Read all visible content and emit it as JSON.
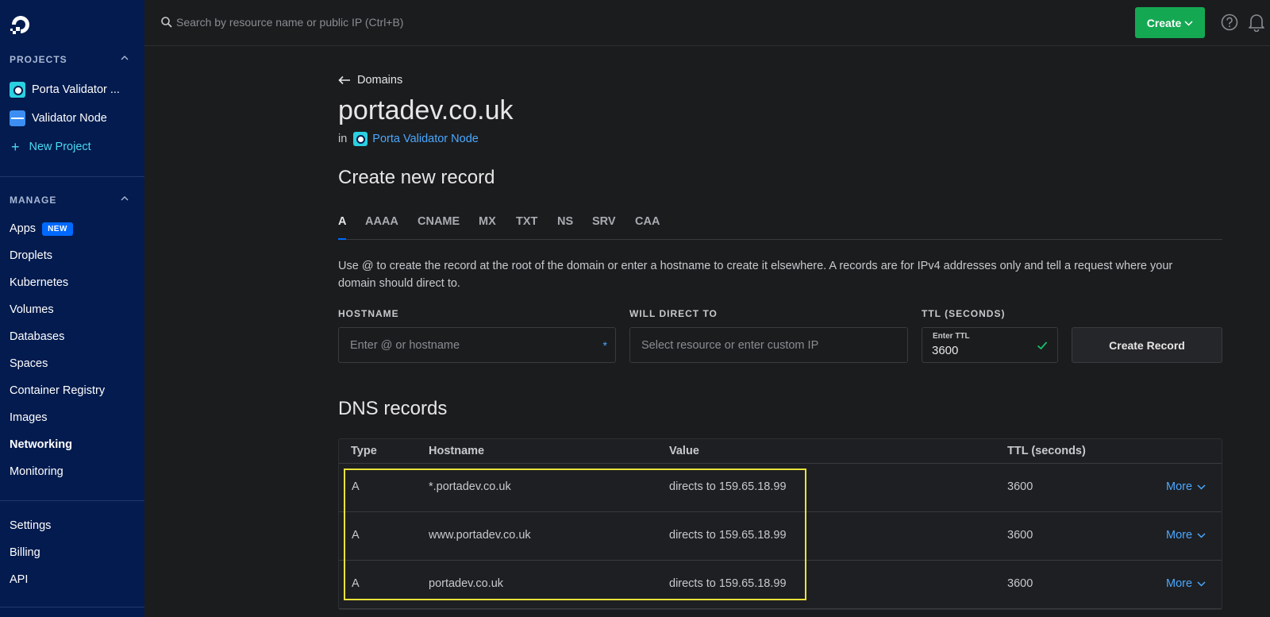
{
  "sidebar": {
    "projects_heading": "PROJECTS",
    "projects": [
      {
        "label": "Porta Validator ..."
      },
      {
        "label": "Validator Node"
      }
    ],
    "new_project": "New Project",
    "manage_heading": "MANAGE",
    "manage_items": [
      {
        "label": "Apps",
        "badge": "NEW"
      },
      {
        "label": "Droplets"
      },
      {
        "label": "Kubernetes"
      },
      {
        "label": "Volumes"
      },
      {
        "label": "Databases"
      },
      {
        "label": "Spaces"
      },
      {
        "label": "Container Registry"
      },
      {
        "label": "Images"
      },
      {
        "label": "Networking"
      },
      {
        "label": "Monitoring"
      }
    ],
    "bottom_items": [
      {
        "label": "Settings"
      },
      {
        "label": "Billing"
      },
      {
        "label": "API"
      }
    ]
  },
  "topbar": {
    "search_placeholder": "Search by resource name or public IP (Ctrl+B)",
    "create_label": "Create"
  },
  "page": {
    "back_label": "Domains",
    "domain": "portadev.co.uk",
    "in_label": "in",
    "project_link": "Porta Validator Node",
    "create_title": "Create new record",
    "tabs": [
      "A",
      "AAAA",
      "CNAME",
      "MX",
      "TXT",
      "NS",
      "SRV",
      "CAA"
    ],
    "description": "Use @ to create the record at the root of the domain or enter a hostname to create it elsewhere. A records are for IPv4 addresses only and tell a request where your domain should direct to.",
    "hostname_label": "HOSTNAME",
    "hostname_placeholder": "Enter @ or hostname",
    "required_mark": "*",
    "direct_label": "WILL DIRECT TO",
    "direct_placeholder": "Select resource or enter custom IP",
    "ttl_label": "TTL (SECONDS)",
    "ttl_inner_label": "Enter TTL",
    "ttl_value": "3600",
    "create_record_label": "Create Record",
    "dns_title": "DNS records"
  },
  "dns_table": {
    "headers": [
      "Type",
      "Hostname",
      "Value",
      "TTL (seconds)"
    ],
    "rows": [
      {
        "type": "A",
        "hostname": "*.portadev.co.uk",
        "value": "directs to 159.65.18.99",
        "ttl": "3600",
        "action": "More"
      },
      {
        "type": "A",
        "hostname": "www.portadev.co.uk",
        "value": "directs to 159.65.18.99",
        "ttl": "3600",
        "action": "More"
      },
      {
        "type": "A",
        "hostname": "portadev.co.uk",
        "value": "directs to 159.65.18.99",
        "ttl": "3600",
        "action": "More"
      }
    ]
  },
  "colors": {
    "sidebar_bg": "#031b4e",
    "accent_green": "#15a853",
    "link_blue": "#4aa8ff",
    "highlight_yellow": "#e8e23a"
  }
}
